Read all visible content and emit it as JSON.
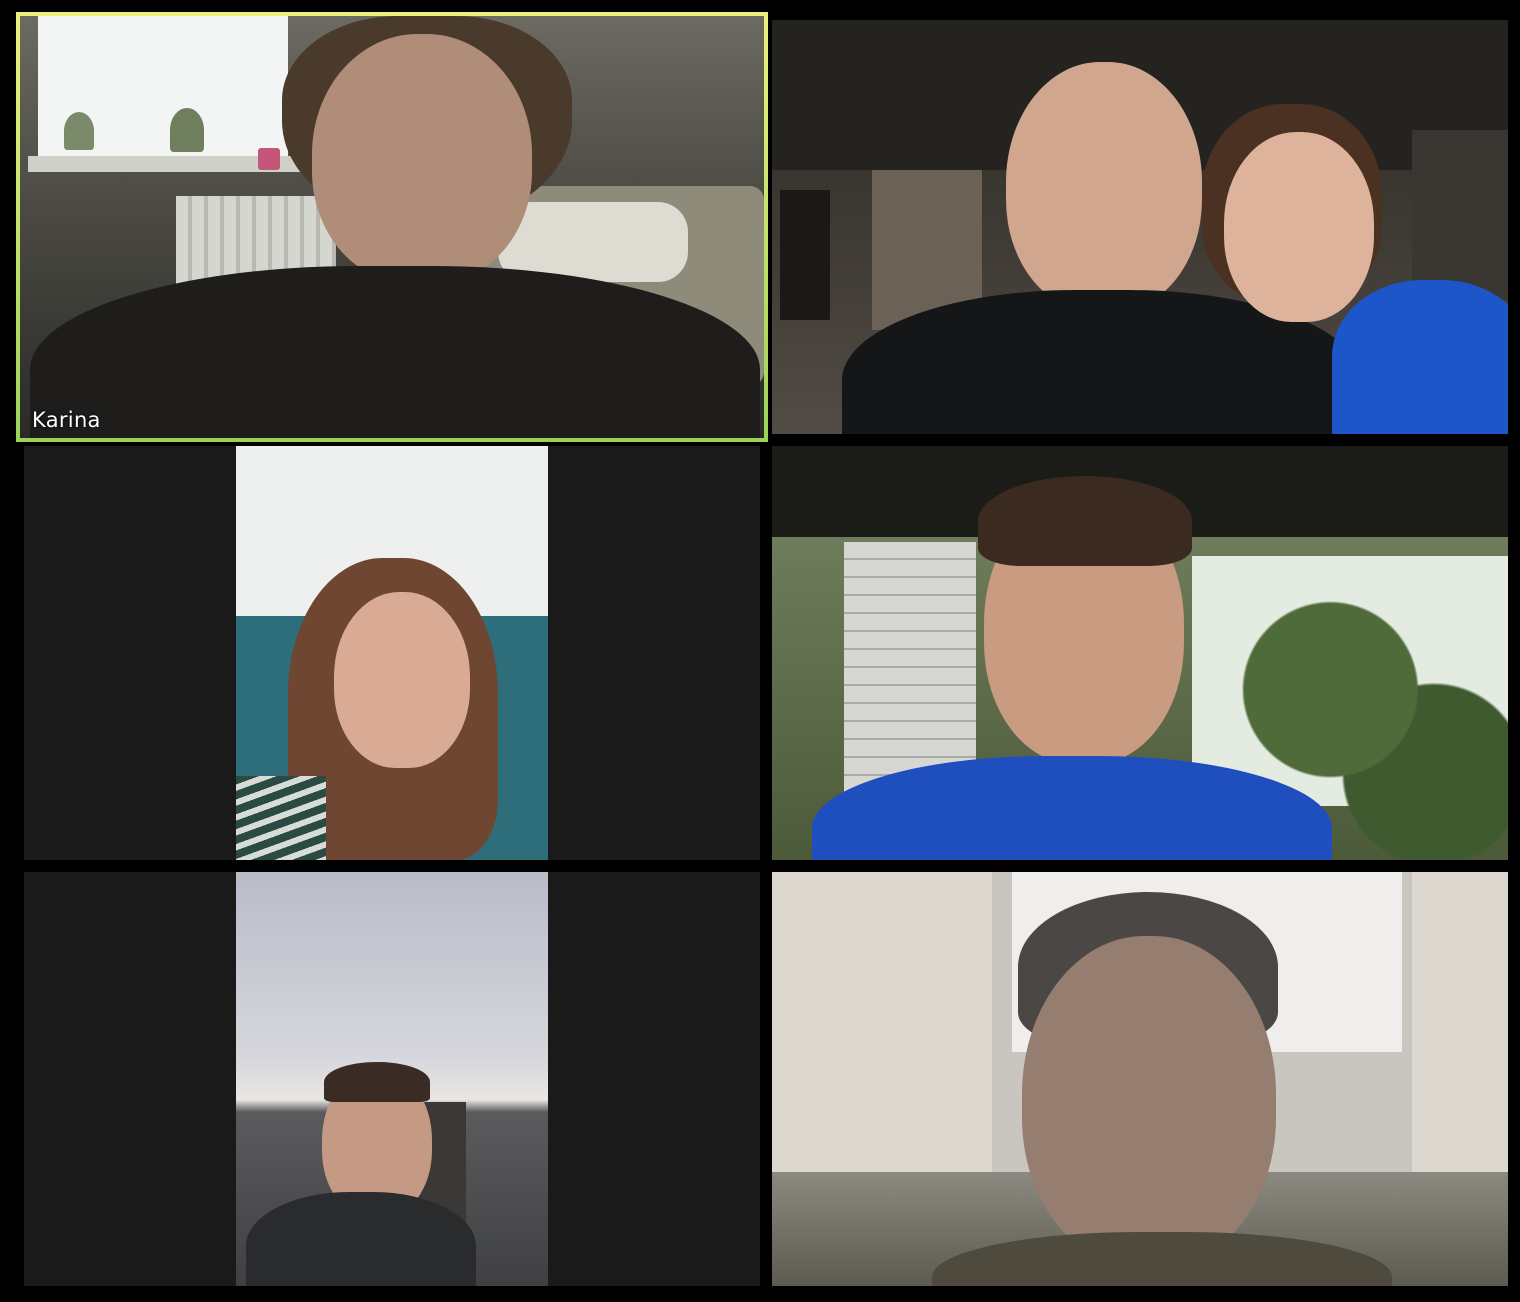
{
  "meeting": {
    "gallery": [
      {
        "display_name": "Karina",
        "active_speaker": true
      },
      {
        "display_name": ""
      },
      {
        "display_name": ""
      },
      {
        "display_name": ""
      },
      {
        "display_name": ""
      },
      {
        "display_name": ""
      }
    ]
  },
  "colors": {
    "background": "#000000",
    "tile_background": "#1a1a1a",
    "active_speaker_border": "#d9ec6e",
    "name_text": "#ffffff"
  }
}
